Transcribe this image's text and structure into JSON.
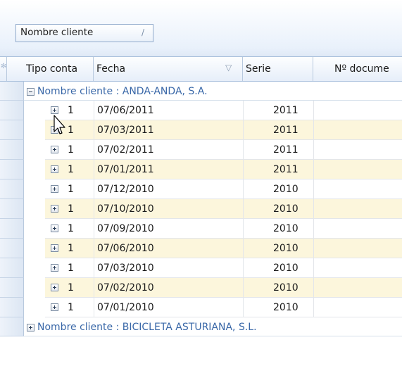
{
  "group_by": {
    "chip_label": "Nombre cliente",
    "sort_icon": "sort-indicator-icon"
  },
  "columns": {
    "tipo": "Tipo conta",
    "fecha": "Fecha",
    "serie": "Serie",
    "ndoc": "Nº docume"
  },
  "groups": [
    {
      "label": "Nombre cliente : ANDA-ANDA, S.A.",
      "expanded": true,
      "rows": [
        {
          "tipo": "1",
          "fecha": "07/06/2011",
          "serie": "2011"
        },
        {
          "tipo": "1",
          "fecha": "07/03/2011",
          "serie": "2011"
        },
        {
          "tipo": "1",
          "fecha": "07/02/2011",
          "serie": "2011"
        },
        {
          "tipo": "1",
          "fecha": "07/01/2011",
          "serie": "2011"
        },
        {
          "tipo": "1",
          "fecha": "07/12/2010",
          "serie": "2010"
        },
        {
          "tipo": "1",
          "fecha": "07/10/2010",
          "serie": "2010"
        },
        {
          "tipo": "1",
          "fecha": "07/09/2010",
          "serie": "2010"
        },
        {
          "tipo": "1",
          "fecha": "07/06/2010",
          "serie": "2010"
        },
        {
          "tipo": "1",
          "fecha": "07/03/2010",
          "serie": "2010"
        },
        {
          "tipo": "1",
          "fecha": "07/02/2010",
          "serie": "2010"
        },
        {
          "tipo": "1",
          "fecha": "07/01/2010",
          "serie": "2010"
        }
      ]
    },
    {
      "label": "Nombre cliente : BICICLETA ASTURIANA, S.L.",
      "expanded": false
    }
  ],
  "colors": {
    "group_text": "#3a68a8",
    "alt_row": "#fcf6dc",
    "header_border": "#a9c0dc"
  }
}
